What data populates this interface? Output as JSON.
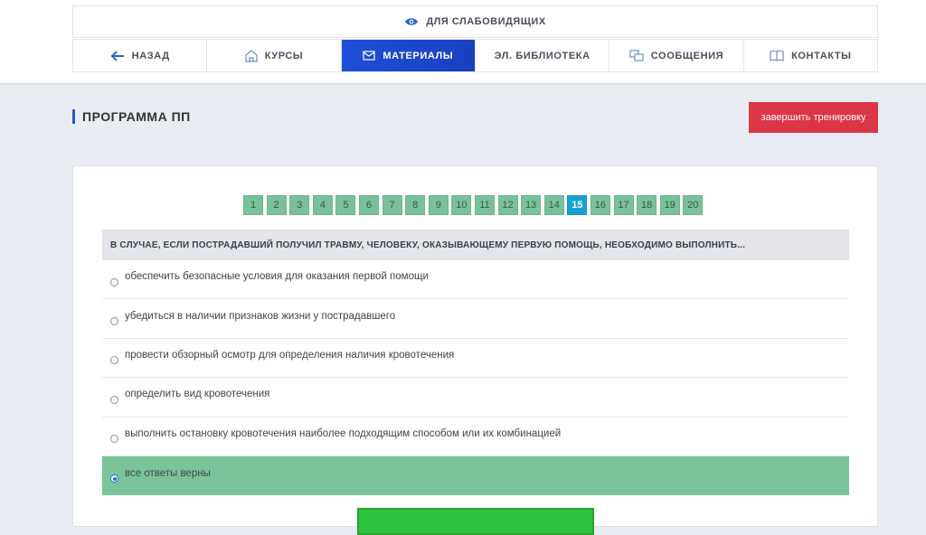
{
  "accessibility": {
    "label": "ДЛЯ СЛАБОВИДЯЩИХ",
    "icon": "eye-icon"
  },
  "nav": {
    "back": {
      "label": "НАЗАД",
      "icon": "arrow-left-icon"
    },
    "courses": {
      "label": "КУРСЫ",
      "icon": "building-icon"
    },
    "materials": {
      "label": "МАТЕРИАЛЫ",
      "icon": "envelope-icon"
    },
    "library": {
      "label": "ЭЛ. БИБЛИОТЕКА"
    },
    "messages": {
      "label": "СООБЩЕНИЯ",
      "icon": "chat-icon"
    },
    "contacts": {
      "label": "КОНТАКТЫ",
      "icon": "book-icon"
    }
  },
  "page": {
    "title": "ПРОГРАММА ПП"
  },
  "finish_button": {
    "label": "завершить тренировку"
  },
  "pager": {
    "pages": [
      "1",
      "2",
      "3",
      "4",
      "5",
      "6",
      "7",
      "8",
      "9",
      "10",
      "11",
      "12",
      "13",
      "14",
      "15",
      "16",
      "17",
      "18",
      "19",
      "20"
    ],
    "current": "15"
  },
  "question": {
    "text": "В СЛУЧАЕ, ЕСЛИ ПОСТРАДАВШИЙ ПОЛУЧИЛ ТРАВМУ, ЧЕЛОВЕКУ, ОКАЗЫВАЮЩЕМУ ПЕРВУЮ ПОМОЩЬ, НЕОБХОДИМО ВЫПОЛНИТЬ...",
    "answers": [
      "обеспечить безопасные условия для оказания первой помощи",
      "убедиться в наличии признаков жизни у пострадавшего",
      "провести обзорный осмотр для определения наличия кровотечения",
      "определить вид кровотечения",
      "выполнить остановку кровотечения наиболее подходящим способом или их комбинацией",
      "все ответы верны"
    ],
    "selected_index": 5
  },
  "colors": {
    "accent_blue": "#1e4fd8",
    "danger_red": "#dc3545",
    "pager_green": "#7ac19b",
    "pager_current": "#17a2d3",
    "selected_answer_green": "#7ac49b",
    "submit_green": "#2fc23f"
  }
}
